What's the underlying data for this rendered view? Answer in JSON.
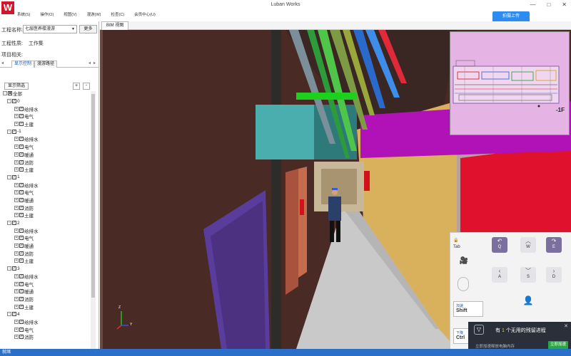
{
  "app": {
    "title": "Luban Works",
    "logo": "W"
  },
  "menu": [
    "系统(S)",
    "操作(O)",
    "视图(V)",
    "漫游(W)",
    "检查(C)",
    "会员中心(U)"
  ],
  "window_controls": {
    "minimize": "—",
    "maximize": "□",
    "close": "✕"
  },
  "upload_button": "拍摄上传",
  "view_tab": "BIM 视图",
  "panel": {
    "project_label": "工程名称:",
    "project_value": "七层医养楼漫游",
    "more_button": "更多",
    "property_label": "工程性质:",
    "property_value": "工作集",
    "related_label": "项目相关:",
    "tabs": [
      "显示控制",
      "漫游路径"
    ],
    "filter_button": "显示筛选",
    "add_label": "+",
    "minus_label": "-"
  },
  "tree": [
    {
      "level": 0,
      "label": "全部"
    },
    {
      "level": 1,
      "label": "0"
    },
    {
      "level": 2,
      "label": "给排水"
    },
    {
      "level": 2,
      "label": "电气"
    },
    {
      "level": 2,
      "label": "土建"
    },
    {
      "level": 1,
      "label": "-1"
    },
    {
      "level": 2,
      "label": "给排水"
    },
    {
      "level": 2,
      "label": "电气"
    },
    {
      "level": 2,
      "label": "暖通"
    },
    {
      "level": 2,
      "label": "消防"
    },
    {
      "level": 2,
      "label": "土建"
    },
    {
      "level": 1,
      "label": "1"
    },
    {
      "level": 2,
      "label": "给排水"
    },
    {
      "level": 2,
      "label": "电气"
    },
    {
      "level": 2,
      "label": "暖通"
    },
    {
      "level": 2,
      "label": "消防"
    },
    {
      "level": 2,
      "label": "土建"
    },
    {
      "level": 1,
      "label": "2"
    },
    {
      "level": 2,
      "label": "给排水"
    },
    {
      "level": 2,
      "label": "电气"
    },
    {
      "level": 2,
      "label": "暖通"
    },
    {
      "level": 2,
      "label": "消防"
    },
    {
      "level": 2,
      "label": "土建"
    },
    {
      "level": 1,
      "label": "3"
    },
    {
      "level": 2,
      "label": "给排水"
    },
    {
      "level": 2,
      "label": "电气"
    },
    {
      "level": 2,
      "label": "暖通"
    },
    {
      "level": 2,
      "label": "消防"
    },
    {
      "level": 2,
      "label": "土建"
    },
    {
      "level": 1,
      "label": "4"
    },
    {
      "level": 2,
      "label": "给排水"
    },
    {
      "level": 2,
      "label": "电气"
    },
    {
      "level": 2,
      "label": "消防"
    }
  ],
  "minimap": {
    "floor": "-1F"
  },
  "axes": {
    "z": "Z",
    "y": "Y"
  },
  "controls": {
    "tab_key": "Tab",
    "q_key": "Q",
    "w_key": "W",
    "e_key": "E",
    "a_key": "A",
    "s_key": "S",
    "d_key": "D",
    "shift_key": "Shift",
    "shift_hint": "加速",
    "ctrl_key": "Ctrl",
    "ctrl_hint": "下降"
  },
  "notification": {
    "prefix": "有",
    "count": "1",
    "suffix": "个无用的残留进程",
    "sub": "立即加速释放电脑内存",
    "button": "立即加速",
    "close": "✕"
  },
  "status": "就绪"
}
